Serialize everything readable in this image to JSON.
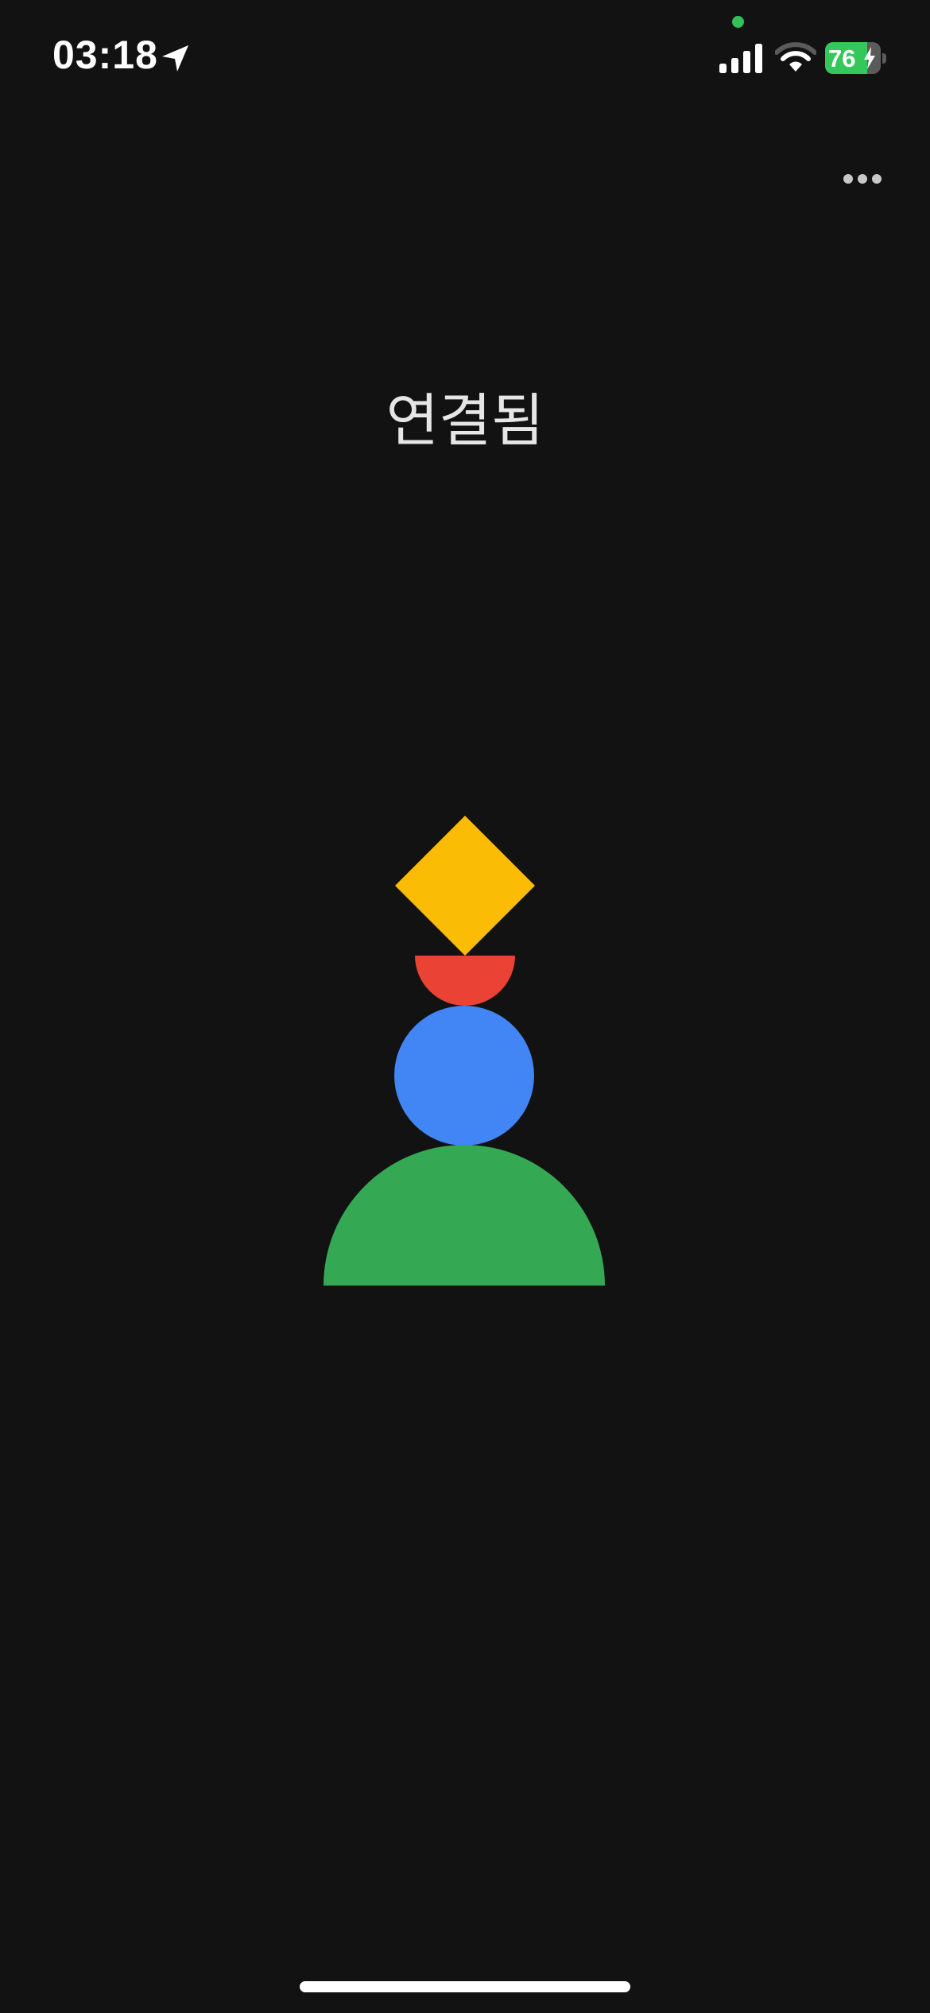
{
  "status_bar": {
    "time": "03:18",
    "battery_level": "76",
    "battery_fraction": 0.76,
    "icons": [
      "location-arrow-icon",
      "privacy-dot",
      "cellular-signal-icon",
      "wifi-icon",
      "battery-icon",
      "charging-bolt-icon"
    ]
  },
  "header": {
    "more_icon": "ellipsis-icon"
  },
  "main": {
    "title": "연결됨"
  },
  "logo": {
    "shapes": [
      "yellow-diamond",
      "red-half-circle",
      "blue-circle",
      "green-half-circle"
    ]
  },
  "colors": {
    "background": "#121212",
    "yellow": "#fbbc05",
    "red": "#ea4335",
    "blue": "#4285f4",
    "green": "#34a853",
    "battery_green": "#34c759",
    "privacy_dot": "#32c05a"
  }
}
